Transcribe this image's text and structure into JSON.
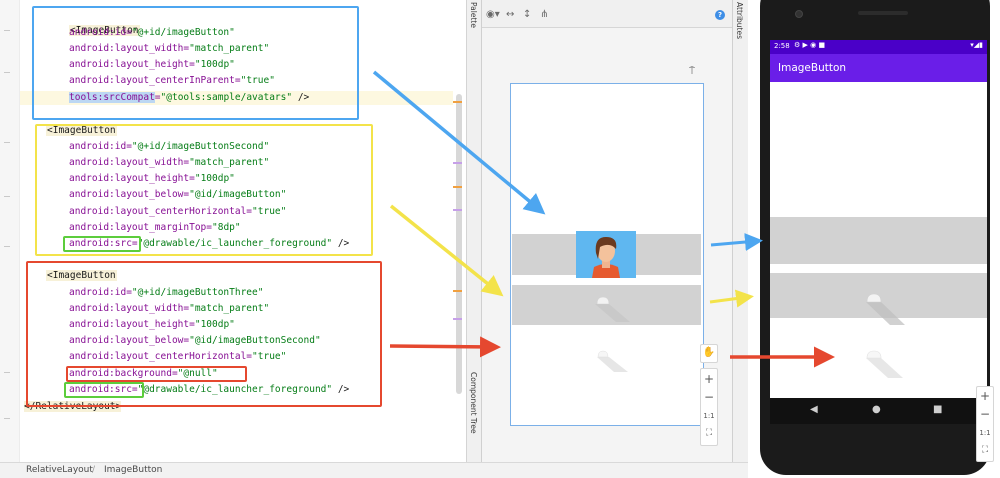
{
  "editor": {
    "lines": [
      {
        "tag": "<ImageButton"
      },
      {
        "attr": "android:id=",
        "val": "\"@+id/imageButton\""
      },
      {
        "attr": "android:layout_width=",
        "val": "\"match_parent\""
      },
      {
        "attr": "android:layout_height=",
        "val": "\"100dp\""
      },
      {
        "attr": "android:layout_centerInParent=",
        "val": "\"true\""
      },
      {
        "tool": "tools:srcCompat",
        "attr": "=",
        "val": "\"@tools:sample/avatars\"",
        "end": " />"
      },
      {
        "tag": "<ImageButton"
      },
      {
        "attr": "android:id=",
        "val": "\"@+id/imageButtonSecond\""
      },
      {
        "attr": "android:layout_width=",
        "val": "\"match_parent\""
      },
      {
        "attr": "android:layout_height=",
        "val": "\"100dp\""
      },
      {
        "attr": "android:layout_below=",
        "val": "\"@id/imageButton\""
      },
      {
        "attr": "android:layout_centerHorizontal=",
        "val": "\"true\""
      },
      {
        "attr": "android:layout_marginTop=",
        "val": "\"8dp\""
      },
      {
        "attr": "android:src=",
        "val": "\"@drawable/ic_launcher_foreground\"",
        "end": " />"
      },
      {
        "tag": "<ImageButton"
      },
      {
        "attr": "android:id=",
        "val": "\"@+id/imageButtonThree\""
      },
      {
        "attr": "android:layout_width=",
        "val": "\"match_parent\""
      },
      {
        "attr": "android:layout_height=",
        "val": "\"100dp\""
      },
      {
        "attr": "android:layout_below=",
        "val": "\"@id/imageButtonSecond\""
      },
      {
        "attr": "android:layout_centerHorizontal=",
        "val": "\"true\""
      },
      {
        "attr": "android:background=",
        "val": "\"@null\""
      },
      {
        "attr": "android:src=",
        "val": "\"@drawable/ic_launcher_foreground\"",
        "end": " />"
      },
      {
        "close": "</RelativeLayout>"
      }
    ]
  },
  "tool_windows": {
    "palette": "Palette",
    "component_tree": "Component Tree",
    "attributes": "Attributes"
  },
  "design_toolbar": {
    "eye_icon": "eye-icon",
    "help": "?"
  },
  "zoom_controls": {
    "plus": "+",
    "minus": "−",
    "one_to_one": "1:1"
  },
  "breadcrumb": {
    "items": [
      "RelativeLayout",
      "ImageButton"
    ]
  },
  "phone": {
    "time": "2:58",
    "app_title": "ImageButton",
    "zoom_plus": "+",
    "zoom_minus": "−",
    "zoom_one": "1:1"
  },
  "colors": {
    "blue_box": "#4da6f0",
    "yellow_box": "#f3e34a",
    "red_box": "#e5482f",
    "green_box": "#5ccd3c",
    "app_bar": "#6a1ee8",
    "status_bar": "#4a00c8"
  }
}
